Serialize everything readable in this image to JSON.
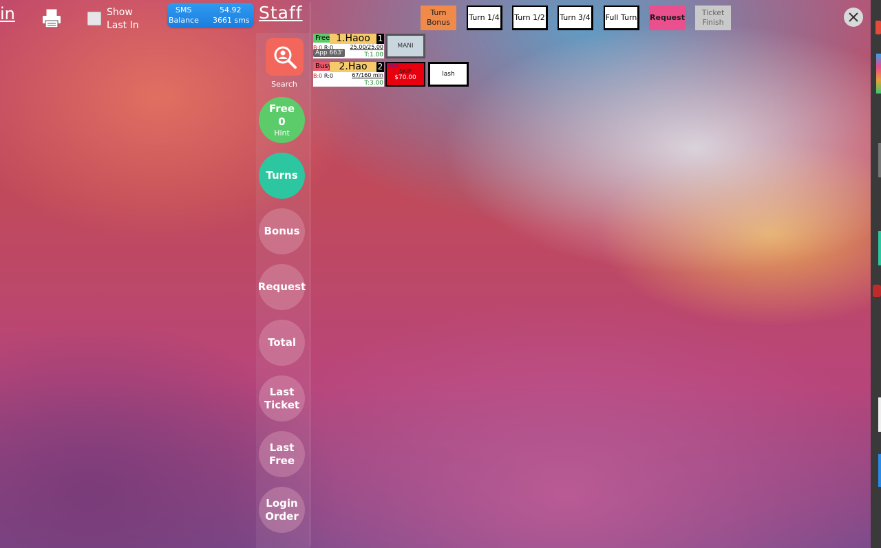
{
  "top_left": {
    "login_fragment": "in",
    "show_last_in_label": "Show Last In",
    "sms_label_1": "SMS",
    "sms_label_2": "Balance",
    "sms_amount": "54.92",
    "sms_count": "3661 sms"
  },
  "header": {
    "title": "Staff"
  },
  "sidebar": {
    "search_label": "Search",
    "free": {
      "label": "Free",
      "count": "0",
      "hint": "Hint"
    },
    "items": [
      "Turns",
      "Bonus",
      "Request",
      "Total",
      "Last Ticket",
      "Last Free",
      "Login Order"
    ]
  },
  "toolbar": {
    "buttons": [
      {
        "label": "Turn Bonus",
        "style": "orange"
      },
      {
        "label": "Turn 1/4",
        "style": "white"
      },
      {
        "label": "Turn 1/2",
        "style": "white"
      },
      {
        "label": "Turn 3/4",
        "style": "white"
      },
      {
        "label": "Full Turn",
        "style": "white"
      },
      {
        "label": "Request",
        "style": "pink"
      },
      {
        "label": "Ticket Finish",
        "style": "gray"
      }
    ]
  },
  "staff": [
    {
      "status": "Free",
      "status_color": "#5ccc6a",
      "name": "1.Haoo",
      "number": "1",
      "b": "B:0",
      "r": "R:0",
      "count": "25.00/25.00",
      "app": "App 663'",
      "turn": "T:1.00",
      "tickets": [
        {
          "label": "MANI",
          "style": "gray"
        }
      ]
    },
    {
      "status": "Busy",
      "status_color": "#e85a6a",
      "name": "2.Hao",
      "number": "2",
      "b": "B:0",
      "r": "R:0",
      "count": "67/160 min",
      "turn": "T:3.00",
      "tickets": [
        {
          "badge": "Give",
          "label": "SKIP",
          "amount": "$70.00",
          "style": "red"
        },
        {
          "label": "lash",
          "style": "white"
        }
      ]
    }
  ],
  "colors": {
    "accent_search": "#f2665c",
    "free_circle": "#5ccc6a",
    "turns_circle": "#2cc7a0",
    "sms_blue": "#1b7ddf",
    "busy": "#e85a6a"
  }
}
